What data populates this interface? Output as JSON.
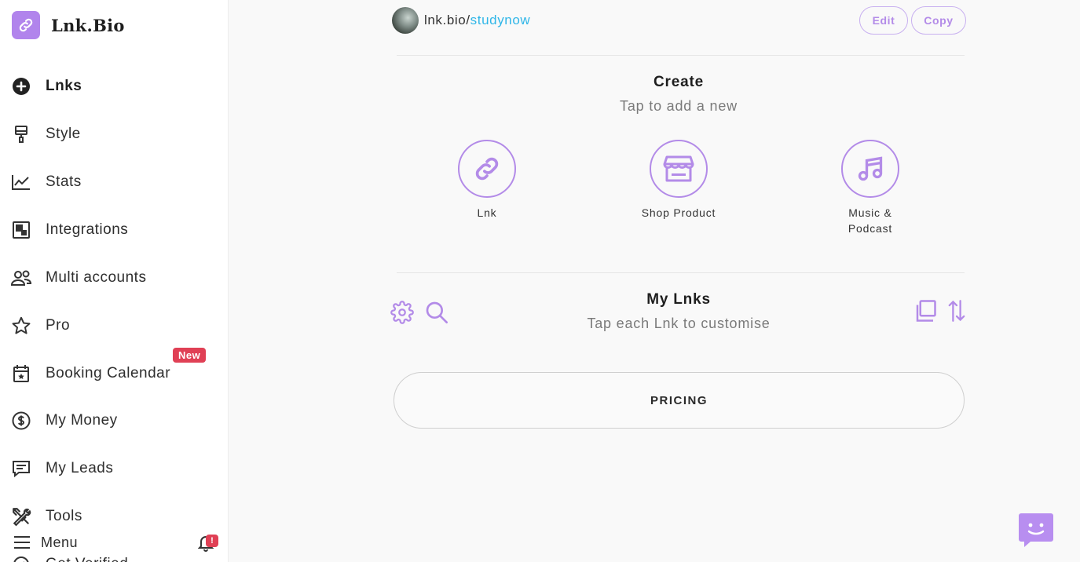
{
  "brand": {
    "name": "Lnk.Bio"
  },
  "sidebar": {
    "items": [
      {
        "label": "Lnks",
        "icon": "plus-circle-icon"
      },
      {
        "label": "Style",
        "icon": "paint-roller-icon"
      },
      {
        "label": "Stats",
        "icon": "chart-line-icon"
      },
      {
        "label": "Integrations",
        "icon": "integrations-icon"
      },
      {
        "label": "Multi accounts",
        "icon": "users-icon"
      },
      {
        "label": "Pro",
        "icon": "star-icon"
      },
      {
        "label": "Booking Calendar",
        "icon": "calendar-star-icon",
        "badge": "New"
      },
      {
        "label": "My Money",
        "icon": "dollar-circle-icon"
      },
      {
        "label": "My Leads",
        "icon": "message-square-icon"
      },
      {
        "label": "Tools",
        "icon": "tools-icon"
      },
      {
        "label": "Get Verified",
        "icon": "verified-badge-icon"
      }
    ],
    "menu_label": "Menu",
    "notification_count": "!"
  },
  "header": {
    "url_prefix": "lnk.bio/",
    "url_slug": "studynow",
    "edit_label": "Edit",
    "copy_label": "Copy"
  },
  "create": {
    "title": "Create",
    "subtitle": "Tap to add a new",
    "items": [
      {
        "label": "Lnk",
        "icon": "link-icon"
      },
      {
        "label": "Shop Product",
        "icon": "shop-icon"
      },
      {
        "label": "Music & Podcast",
        "icon": "music-icon"
      }
    ]
  },
  "my_lnks": {
    "title": "My Lnks",
    "subtitle": "Tap each Lnk to customise",
    "links": [
      {
        "label": "PRICING"
      }
    ]
  },
  "colors": {
    "accent": "#b38be8",
    "brand": "#b184ec",
    "link": "#2fb6e8",
    "badge": "#e04055"
  }
}
